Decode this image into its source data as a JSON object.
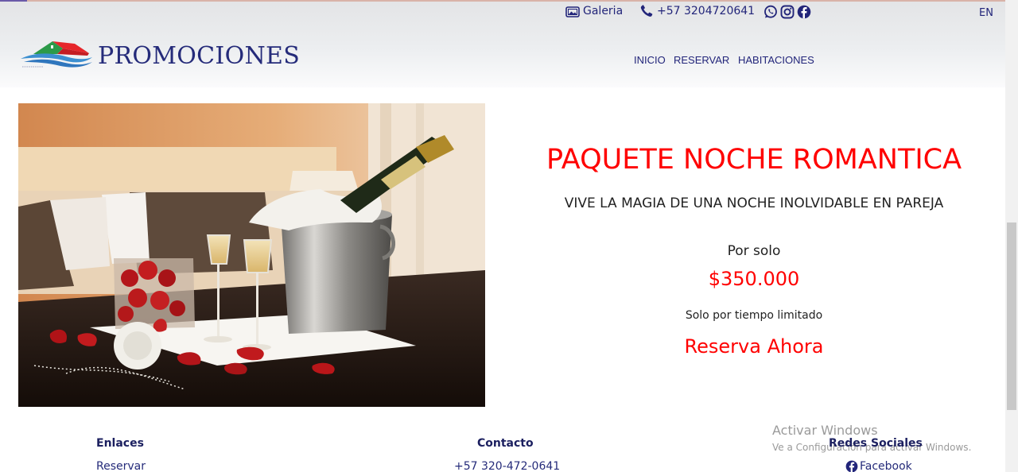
{
  "topbar": {
    "gallery_label": "Galeria",
    "phone": "+57 3204720641",
    "social_icons": [
      "whatsapp-icon",
      "instagram-icon",
      "facebook-icon"
    ],
    "language": "EN"
  },
  "header": {
    "brand": "PROMOCIONES",
    "nav": [
      "INICIO",
      "RESERVAR",
      "HABITACIONES"
    ]
  },
  "promo": {
    "title": "PAQUETE NOCHE ROMANTICA",
    "subtitle": "VIVE LA MAGIA DE UNA NOCHE INOLVIDABLE EN PAREJA",
    "price_prefix": "Por solo",
    "price": "$350.000",
    "limited": "Solo por tiempo limitado",
    "cta": "Reserva Ahora"
  },
  "footer": {
    "links_heading": "Enlaces",
    "links": [
      "Reservar"
    ],
    "contact_heading": "Contacto",
    "contact_phone": "+57 320-472-0641",
    "social_heading": "Redes Sociales",
    "social_links": [
      "Facebook"
    ]
  },
  "watermark": {
    "line1": "Activar Windows",
    "line2": "Ve a Configuración para activar Windows."
  },
  "colors": {
    "accent_red": "#ff0000",
    "navy": "#22257a"
  }
}
